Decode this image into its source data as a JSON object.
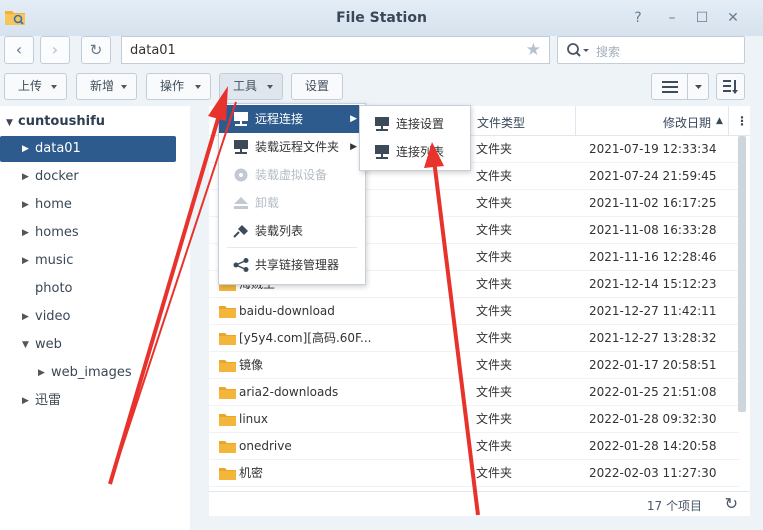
{
  "window": {
    "title": "File Station",
    "help_label": "?",
    "min_label": "–",
    "max_label": "☐",
    "close_label": "✕"
  },
  "nav": {
    "back": "‹",
    "forward": "›",
    "refresh": "↻",
    "path": "data01",
    "star": "★",
    "search_placeholder": "搜索"
  },
  "toolbar": {
    "upload": "上传",
    "create": "新增",
    "action": "操作",
    "tools": "工具",
    "settings": "设置"
  },
  "tree": {
    "root": "cuntoushifu",
    "items": [
      {
        "label": "data01",
        "arrow": "▶",
        "selected": true
      },
      {
        "label": "docker",
        "arrow": "▶"
      },
      {
        "label": "home",
        "arrow": "▶"
      },
      {
        "label": "homes",
        "arrow": "▶"
      },
      {
        "label": "music",
        "arrow": "▶"
      },
      {
        "label": "photo",
        "arrow": ""
      },
      {
        "label": "video",
        "arrow": "▶"
      },
      {
        "label": "web",
        "arrow": "▼"
      },
      {
        "label": "web_images",
        "arrow": "▶",
        "child": true
      },
      {
        "label": "迅雷",
        "arrow": "▶"
      }
    ]
  },
  "list": {
    "headers": {
      "type": "文件类型",
      "modified": "修改日期",
      "sort": "▲"
    },
    "rows": [
      {
        "name": "",
        "type": "文件夹",
        "date": "2021-07-19 12:33:34"
      },
      {
        "name": "",
        "type": "文件夹",
        "date": "2021-07-24 21:59:45"
      },
      {
        "name": "",
        "type": "文件夹",
        "date": "2021-11-02 16:17:25"
      },
      {
        "name": "",
        "type": "文件夹",
        "date": "2021-11-08 16:33:28"
      },
      {
        "name": "",
        "type": "文件夹",
        "date": "2021-11-16 12:28:46"
      },
      {
        "name": "海贼王",
        "type": "文件夹",
        "date": "2021-12-14 15:12:23"
      },
      {
        "name": "baidu-download",
        "type": "文件夹",
        "date": "2021-12-27 11:42:11"
      },
      {
        "name": "[y5y4.com][高码.60F...",
        "type": "文件夹",
        "date": "2021-12-27 13:28:32"
      },
      {
        "name": "镜像",
        "type": "文件夹",
        "date": "2022-01-17 20:58:51"
      },
      {
        "name": "aria2-downloads",
        "type": "文件夹",
        "date": "2022-01-25 21:51:08"
      },
      {
        "name": "linux",
        "type": "文件夹",
        "date": "2022-01-28 09:32:30"
      },
      {
        "name": "onedrive",
        "type": "文件夹",
        "date": "2022-01-28 14:20:58"
      },
      {
        "name": "机密",
        "type": "文件夹",
        "date": "2022-02-03 11:27:30"
      }
    ],
    "count": "17 个项目"
  },
  "tools_menu": {
    "items": [
      {
        "label": "远程连接",
        "icon": "network-icon",
        "highlighted": true,
        "submenu": true
      },
      {
        "label": "装载远程文件夹",
        "icon": "network-icon",
        "submenu": true
      },
      {
        "label": "装载虚拟设备",
        "icon": "disc-icon",
        "disabled": true
      },
      {
        "label": "卸载",
        "icon": "eject-icon",
        "disabled": true
      },
      {
        "label": "装载列表",
        "icon": "plug-icon"
      },
      {
        "label": "共享链接管理器",
        "icon": "share-icon"
      }
    ]
  },
  "remote_submenu": {
    "items": [
      {
        "label": "连接设置",
        "icon": "network-icon"
      },
      {
        "label": "连接列表",
        "icon": "network-icon"
      }
    ]
  },
  "colors": {
    "accent": "#2e5b8e",
    "folder": "#f4b63a",
    "arrow": "#e8332d"
  }
}
